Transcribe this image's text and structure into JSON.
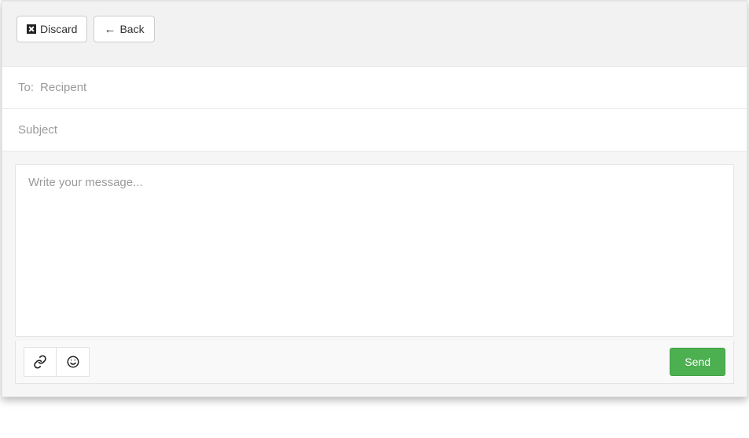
{
  "header": {
    "discard_label": "Discard",
    "back_label": "Back"
  },
  "fields": {
    "to_label": "To:",
    "to_placeholder": "Recipent",
    "to_value": "",
    "subject_placeholder": "Subject",
    "subject_value": ""
  },
  "editor": {
    "placeholder": "Write your message...",
    "value": ""
  },
  "footer": {
    "send_label": "Send"
  },
  "colors": {
    "send_bg": "#4caf50",
    "panel_bg": "#f2f2f2",
    "border": "#e4e4e4",
    "placeholder": "#9a9a9a"
  }
}
